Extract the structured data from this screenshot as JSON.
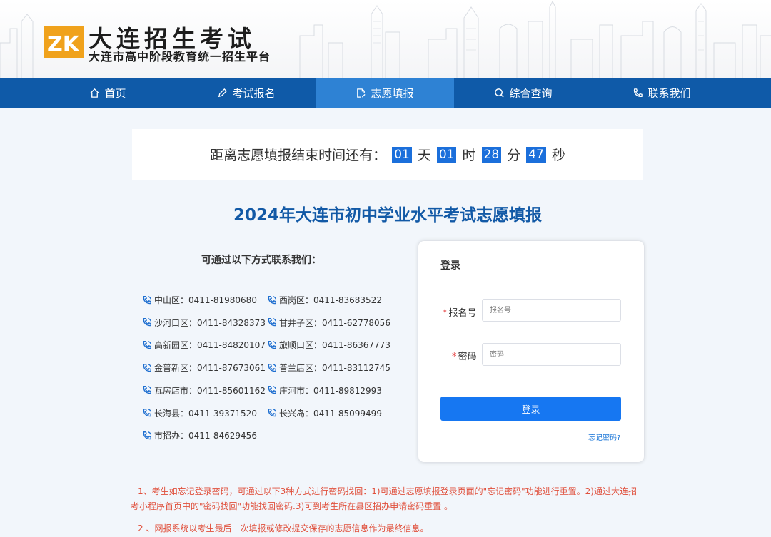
{
  "brand": {
    "logo_text": "ZK",
    "title": "大连招生考试",
    "subtitle": "大连市高中阶段教育统一招生平台"
  },
  "nav": [
    {
      "label": "首页",
      "icon": "home-icon",
      "active": false
    },
    {
      "label": "考试报名",
      "icon": "pencil-icon",
      "active": false
    },
    {
      "label": "志愿填报",
      "icon": "document-edit-icon",
      "active": true
    },
    {
      "label": "综合查询",
      "icon": "search-icon",
      "active": false
    },
    {
      "label": "联系我们",
      "icon": "phone-icon",
      "active": false
    }
  ],
  "countdown": {
    "prefix": "距离志愿填报结束时间还有：",
    "days": "01",
    "days_unit": "天",
    "hours": "01",
    "hours_unit": "时",
    "minutes": "28",
    "minutes_unit": "分",
    "seconds": "47",
    "seconds_unit": "秒"
  },
  "main_title": "2024年大连市初中学业水平考试志愿填报",
  "contacts": {
    "title": "可通过以下方式联系我们：",
    "items": [
      "中山区：0411-81980680",
      "西岗区：0411-83683522",
      "沙河口区：0411-84328373",
      "甘井子区：0411-62778056",
      "高新园区：0411-84820107",
      "旅顺口区：0411-86367773",
      "金普新区：0411-87673061",
      "普兰店区：0411-83112745",
      "瓦房店市：0411-85601162",
      "庄河市：0411-89812993",
      "长海县：0411-39371520",
      "长兴岛：0411-85099499",
      "市招办：0411-84629456"
    ]
  },
  "login": {
    "title": "登录",
    "required_mark": "*",
    "id_label": "报名号",
    "id_placeholder": "报名号",
    "password_label": "密码",
    "password_placeholder": "密码",
    "submit_label": "登录",
    "forgot_label": "忘记密码?"
  },
  "notes": [
    "1、考生如忘记登录密码，可通过以下3种方式进行密码找回：1)可通过志愿填报登录页面的\"忘记密码\"功能进行重置。2)通过大连招考小程序首页中的\"密码找回\"功能找回密码.3)可到考生所在县区招办申请密码重置 。",
    "2 、网报系统以考生最后一次填报或修改提交保存的志愿信息作为最终信息。"
  ],
  "colors": {
    "nav_bg": "#0f5aa8",
    "nav_active": "#2e82d4",
    "title": "#1259a6",
    "countdown_box": "#1b6fdb",
    "button": "#1677f2",
    "note": "#e0503c",
    "required": "#e64545"
  }
}
